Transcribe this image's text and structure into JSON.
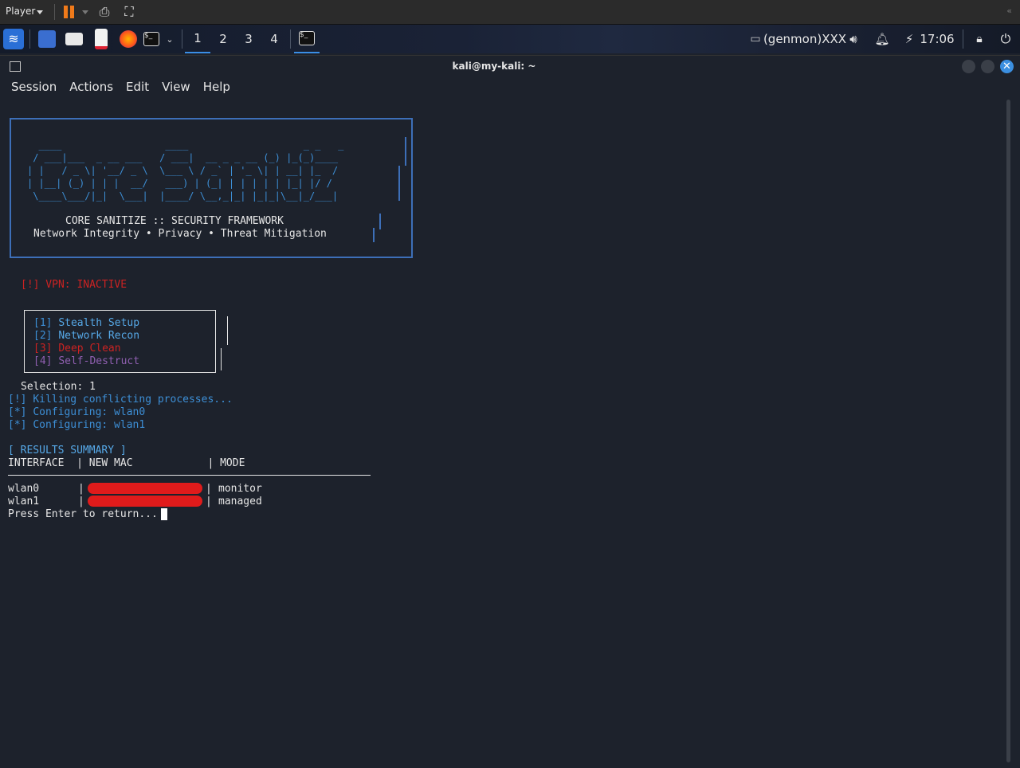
{
  "player": {
    "label": "Player",
    "collapse": "«"
  },
  "panel": {
    "workspaces": [
      "1",
      "2",
      "3",
      "4"
    ],
    "active_workspace": "1",
    "tray_text": "(genmon)XXX",
    "clock": "17:06"
  },
  "window": {
    "title": "kali@my-kali: ~",
    "menu": [
      "Session",
      "Actions",
      "Edit",
      "View",
      "Help"
    ]
  },
  "terminal": {
    "ascii_art": [
      "  ____                  ____                    _ _   _     ",
      " / ___|___  _ __ ___   / ___|  __ _ _ __ (_) |_(_)____  ",
      "| |   / _ \\| '__/ _ \\  \\___ \\ / _` | '_ \\| | __| |_  /  ",
      "| |__| (_) | | |  __/   ___) | (_| | | | | | |_| |/ /   ",
      " \\____\\___/|_|  \\___|  |____/ \\__,_|_| |_|_|\\__|_/___|  "
    ],
    "banner_line1": "CORE SANITIZE :: SECURITY FRAMEWORK",
    "banner_line2": "Network Integrity • Privacy • Threat Mitigation",
    "vpn_status": "[!] VPN: INACTIVE",
    "menu_options": [
      {
        "key": "[1]",
        "label": "Stealth Setup"
      },
      {
        "key": "[2]",
        "label": "Network Recon"
      },
      {
        "key": "[3]",
        "label": "Deep Clean"
      },
      {
        "key": "[4]",
        "label": "Self-Destruct"
      }
    ],
    "selection": "Selection: 1",
    "log": [
      {
        "prefix": "[!]",
        "text": "Killing conflicting processes..."
      },
      {
        "prefix": "[*]",
        "text": "Configuring: wlan0"
      },
      {
        "prefix": "[*]",
        "text": "Configuring: wlan1"
      }
    ],
    "results_title": "[ RESULTS SUMMARY ]",
    "table_header": "INTERFACE  | NEW MAC            | MODE",
    "rows": [
      {
        "interface": "wlan0",
        "mode": "monitor"
      },
      {
        "interface": "wlan1",
        "mode": "managed"
      }
    ],
    "prompt": "Press Enter to return..."
  },
  "colors": {
    "accent_blue": "#3d8fd6",
    "danger_red": "#cc2222",
    "redaction": "#e01b1b",
    "purple": "#8f5fb0"
  }
}
